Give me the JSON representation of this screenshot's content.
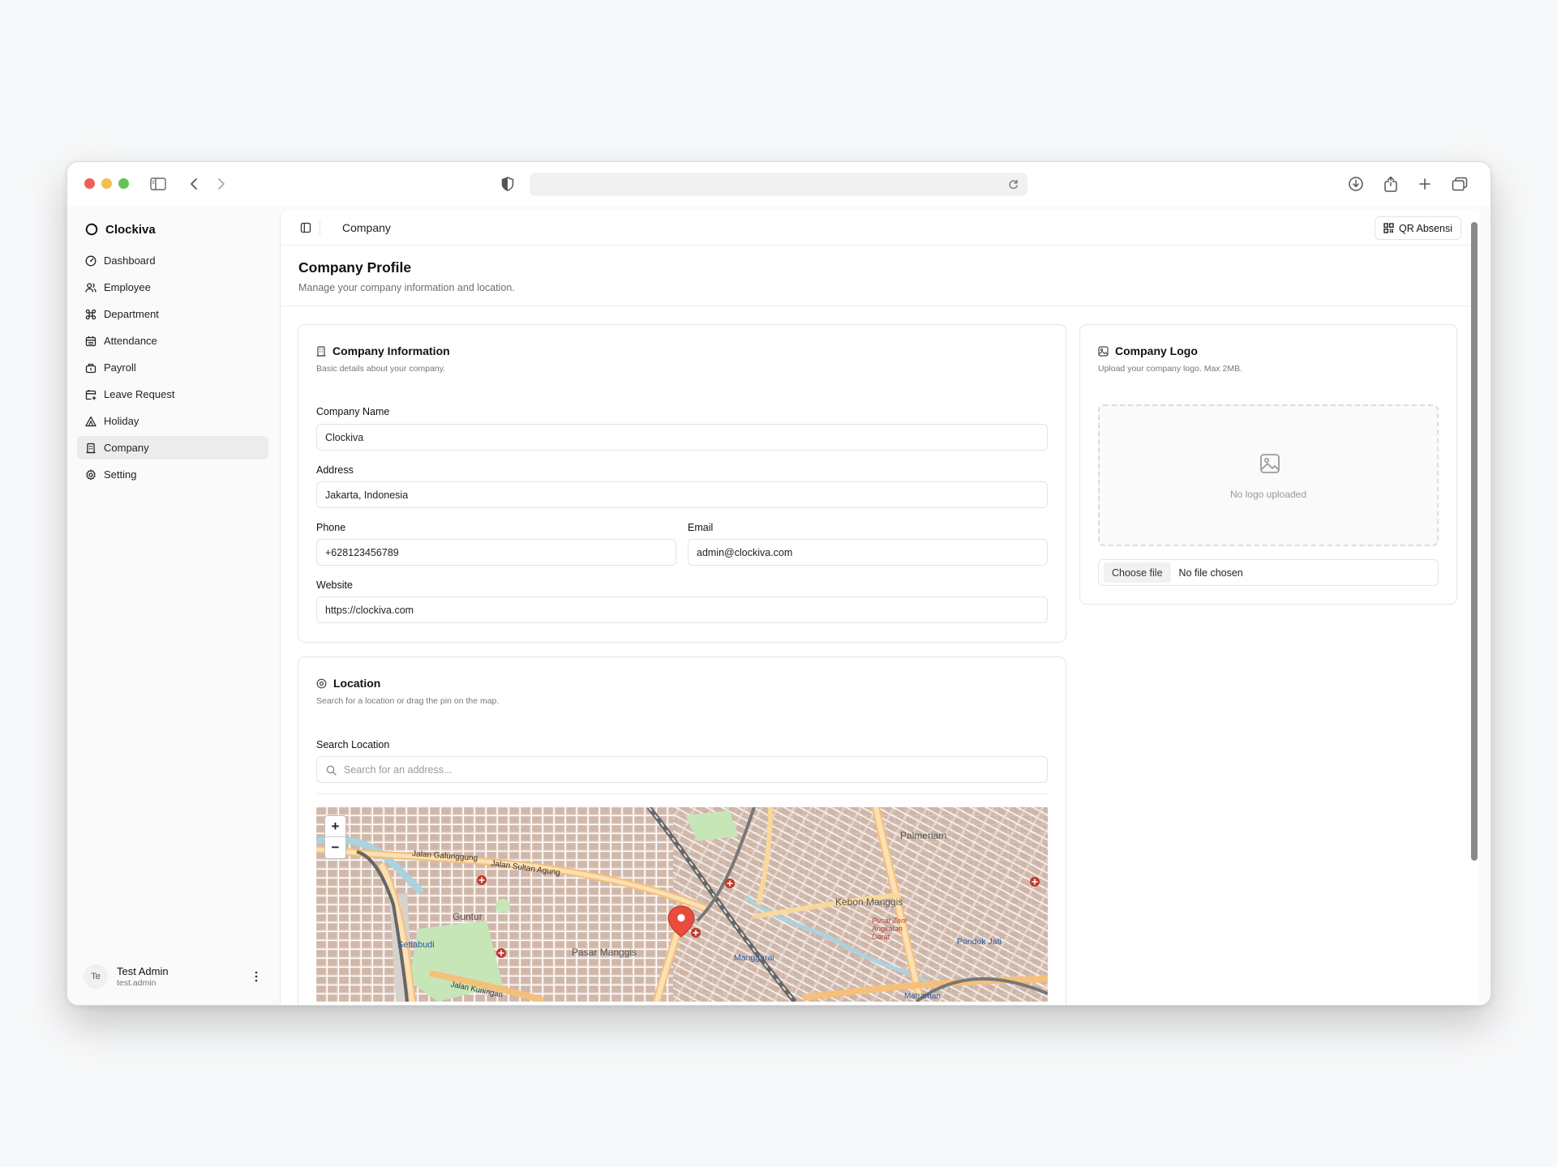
{
  "app": {
    "name": "Clockiva"
  },
  "sidebar": {
    "items": [
      {
        "label": "Dashboard"
      },
      {
        "label": "Employee"
      },
      {
        "label": "Department"
      },
      {
        "label": "Attendance"
      },
      {
        "label": "Payroll"
      },
      {
        "label": "Leave Request"
      },
      {
        "label": "Holiday"
      },
      {
        "label": "Company"
      },
      {
        "label": "Setting"
      }
    ],
    "active": "Company"
  },
  "user": {
    "initials": "Te",
    "name": "Test Admin",
    "username": "test.admin"
  },
  "topbar": {
    "breadcrumb": "Company",
    "qr_button": "QR Absensi"
  },
  "page": {
    "title": "Company Profile",
    "subtitle": "Manage your company information and location."
  },
  "company_info": {
    "title": "Company Information",
    "subtitle": "Basic details about your company.",
    "fields": {
      "name_label": "Company Name",
      "name_value": "Clockiva",
      "address_label": "Address",
      "address_value": "Jakarta, Indonesia",
      "phone_label": "Phone",
      "phone_value": "+628123456789",
      "email_label": "Email",
      "email_value": "admin@clockiva.com",
      "website_label": "Website",
      "website_value": "https://clockiva.com"
    }
  },
  "company_logo": {
    "title": "Company Logo",
    "subtitle": "Upload your company logo. Max 2MB.",
    "empty_text": "No logo uploaded",
    "choose_file": "Choose file",
    "file_status": "No file chosen"
  },
  "location": {
    "title": "Location",
    "subtitle": "Search for a location or drag the pin on the map.",
    "search_label": "Search Location",
    "search_placeholder": "Search for an address...",
    "map": {
      "zoom_in": "+",
      "zoom_out": "−",
      "labels": [
        "Jalan Galunggung",
        "Jalan Sultan Agung",
        "Setiabudi",
        "Guntur",
        "Pasar Manggis",
        "Manggarai",
        "Kebon Manggis",
        "Palmeriam",
        "Pondok Jati",
        "Matraman",
        "Jalan Kuningan",
        "Pusat Zeni Angkatan Darat"
      ]
    }
  },
  "colors": {
    "accent": "#111111",
    "active_bg": "#ececed",
    "map_pin": "#e74c3c",
    "map_road_major": "#f5c07a"
  }
}
